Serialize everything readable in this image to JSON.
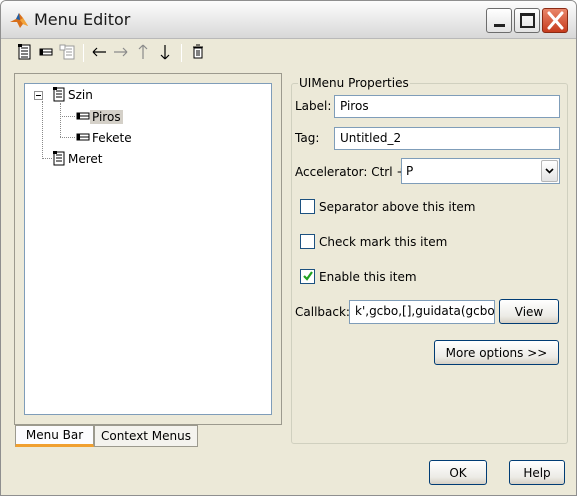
{
  "window": {
    "title": "Menu Editor",
    "icon": "matlab-icon"
  },
  "toolbar": {
    "items": [
      "new-menu-icon",
      "new-menu-item-icon",
      "new-context-menu-icon",
      "move-left-icon",
      "move-right-icon",
      "move-up-icon",
      "move-down-icon",
      "delete-icon"
    ]
  },
  "tree": {
    "nodes": [
      {
        "label": "Szin"
      },
      {
        "label": "Piros",
        "selected": true
      },
      {
        "label": "Fekete"
      },
      {
        "label": "Meret"
      }
    ]
  },
  "tabs": [
    {
      "label": "Menu Bar",
      "active": true
    },
    {
      "label": "Context Menus",
      "active": false
    }
  ],
  "properties": {
    "group_title": "UIMenu Properties",
    "label_caption": "Label:",
    "label_value": "Piros",
    "tag_caption": "Tag:",
    "tag_value": "Untitled_2",
    "accelerator_caption": "Accelerator: Ctrl +",
    "accelerator_value": "P",
    "separator_label": "Separator above this item",
    "separator_checked": false,
    "checkmark_label": "Check mark this item",
    "checkmark_checked": false,
    "enable_label": "Enable this item",
    "enable_checked": true,
    "callback_caption": "Callback:",
    "callback_value": "k',gcbo,[],guidata(gcbo))",
    "view_label": "View",
    "more_options_label": "More options >>"
  },
  "footer": {
    "ok_label": "OK",
    "help_label": "Help"
  },
  "colors": {
    "accent_tab": "#f0a030",
    "check_green": "#21a121",
    "close_red": "#c63b1d"
  }
}
